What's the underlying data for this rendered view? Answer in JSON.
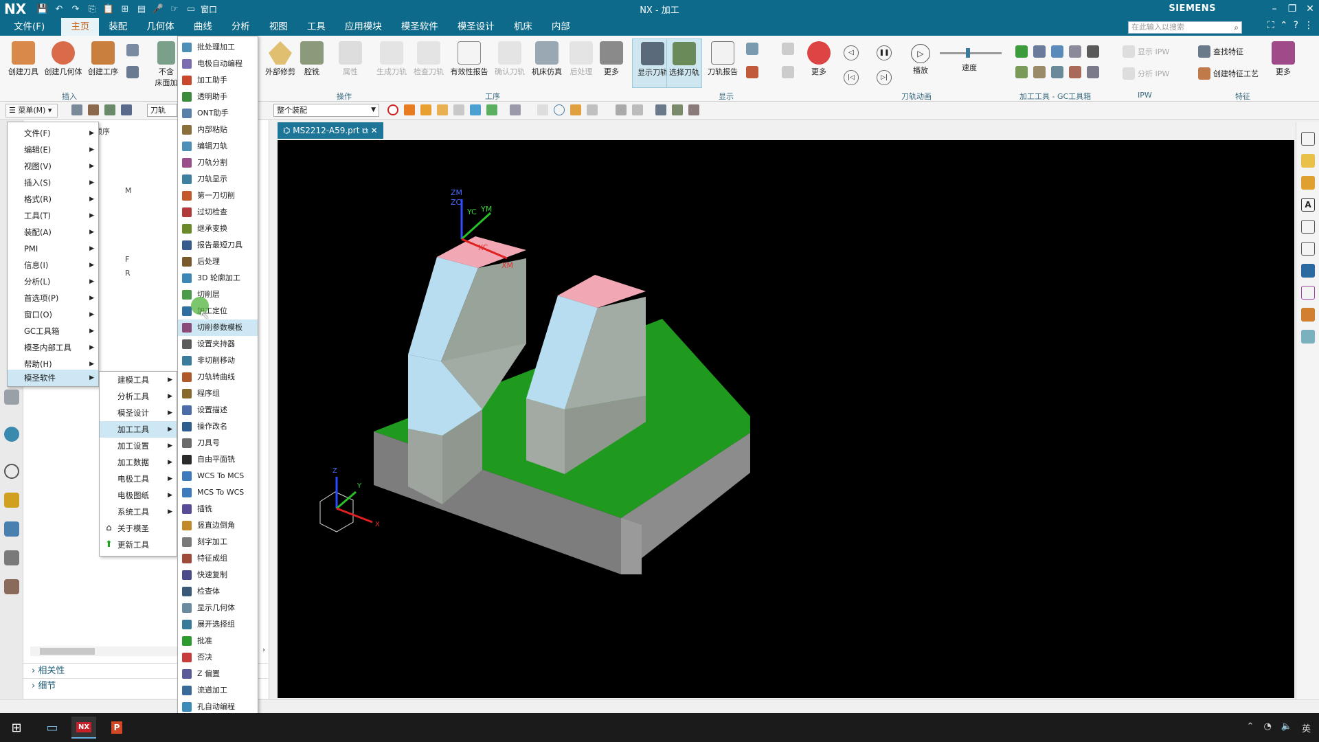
{
  "window": {
    "app_logo": "NX",
    "title": "NX - 加工",
    "brand": "SIEMENS",
    "controls": {
      "minimize": "–",
      "restore": "❐",
      "close": "✕"
    }
  },
  "quick_access": {
    "icons": [
      "save-icon",
      "undo-icon",
      "redo-icon",
      "copy-icon",
      "paste-icon",
      "snap-icon",
      "layer-icon",
      "mic-icon",
      "touch-icon",
      "window-icon"
    ],
    "window_label": "窗口"
  },
  "menu_tabs": [
    {
      "label": "文件(F)"
    },
    {
      "label": "主页"
    },
    {
      "label": "装配"
    },
    {
      "label": "几何体"
    },
    {
      "label": "曲线"
    },
    {
      "label": "分析"
    },
    {
      "label": "视图"
    },
    {
      "label": "工具"
    },
    {
      "label": "应用模块"
    },
    {
      "label": "模圣软件"
    },
    {
      "label": "模圣设计"
    },
    {
      "label": "机床"
    },
    {
      "label": "内部"
    }
  ],
  "active_tab": "主页",
  "search": {
    "placeholder": "在此输入以搜索"
  },
  "ribbon": {
    "insert_group": {
      "label": "插入",
      "buttons": [
        "创建刀具",
        "创建几何体",
        "创建工序"
      ]
    },
    "partial": {
      "label": "不含\n床面加"
    },
    "mid_buttons": [
      "外部修剪",
      "腔铣"
    ],
    "operation_group": {
      "label": "操作",
      "buttons": [
        "属性"
      ]
    },
    "process_group": {
      "label": "工序",
      "buttons": [
        "生成刀轨",
        "检查刀轨",
        "有效性报告",
        "确认刀轨",
        "机床仿真",
        "后处理",
        "更多"
      ]
    },
    "display_group": {
      "label": "显示",
      "buttons": [
        "显示刀轨",
        "选择刀轨",
        "刀轨报告"
      ]
    },
    "more_label": "更多",
    "animation_group": {
      "label": "刀轨动画",
      "play": "播放",
      "speed": "速度"
    },
    "gc_group": {
      "label": "加工工具 - GC工具箱"
    },
    "ipw_group": {
      "label": "IPW",
      "buttons": [
        "显示 IPW",
        "分析 IPW"
      ]
    },
    "feature_group": {
      "label": "特征",
      "buttons": [
        "查找特征",
        "创建特征工艺"
      ]
    },
    "last_more": "更多"
  },
  "toolbar2": {
    "menu_button": "菜单(M)",
    "filter_combo": "刀轨",
    "assembly_combo": "整个装配"
  },
  "main_menu": {
    "items": [
      {
        "label": "文件(F)"
      },
      {
        "label": "编辑(E)"
      },
      {
        "label": "视图(V)"
      },
      {
        "label": "插入(S)"
      },
      {
        "label": "格式(R)"
      },
      {
        "label": "工具(T)"
      },
      {
        "label": "装配(A)"
      },
      {
        "label": "PMI"
      },
      {
        "label": "信息(I)"
      },
      {
        "label": "分析(L)"
      },
      {
        "label": "首选项(P)"
      },
      {
        "label": "窗口(O)"
      },
      {
        "label": "GC工具箱"
      },
      {
        "label": "模圣内部工具"
      },
      {
        "label": "帮助(H)"
      },
      {
        "label": "模圣软件"
      }
    ],
    "highlighted_index": 15
  },
  "sub_menu": {
    "items": [
      {
        "label": "建模工具",
        "arrow": true
      },
      {
        "label": "分析工具",
        "arrow": true
      },
      {
        "label": "模圣设计",
        "arrow": true
      },
      {
        "label": "加工工具",
        "arrow": true
      },
      {
        "label": "加工设置",
        "arrow": true
      },
      {
        "label": "加工数据",
        "arrow": true
      },
      {
        "label": "电极工具",
        "arrow": true
      },
      {
        "label": "电极图纸",
        "arrow": true
      },
      {
        "label": "系统工具",
        "arrow": true
      },
      {
        "label": "关于模圣",
        "arrow": false
      },
      {
        "label": "更新工具",
        "arrow": false
      }
    ],
    "highlighted_index": 3
  },
  "tool_menu": {
    "items": [
      "批处理加工",
      "电极自动编程",
      "加工助手",
      "透明助手",
      "ONT助手",
      "内部粘贴",
      "编辑刀轨",
      "刀轨分割",
      "刀轨显示",
      "第一刀切削",
      "过切检查",
      "继承变换",
      "报告最短刀具",
      "后处理",
      "3D 轮廓加工",
      "切削层",
      "加工定位",
      "切削参数模板",
      "设置夹持器",
      "非切削移动",
      "刀轨转曲线",
      "程序组",
      "设置描述",
      "操作改名",
      "刀具号",
      "自由平面铣",
      "WCS To MCS",
      "MCS To WCS",
      "插铣",
      "竖直边倒角",
      "刻字加工",
      "特征成组",
      "快速复制",
      "检查体",
      "显示几何体",
      "展开选择组",
      "批准",
      "否决",
      "Z 偏置",
      "流道加工",
      "孔自动编程"
    ],
    "icon_colors": [
      "#4d8fb5",
      "#7b6bb0",
      "#c8492e",
      "#3c8c3c",
      "#5a7fa8",
      "#8c6e3c",
      "#4d8fb5",
      "#9a4f8c",
      "#3f7fa0",
      "#c4572b",
      "#b23a3a",
      "#6a8a2a",
      "#355c8c",
      "#7a5a2a",
      "#3e86b8",
      "#4a9a4a",
      "#2f6f9f",
      "#8a4a7a",
      "#5c5c5c",
      "#3c7c9c",
      "#b05a2a",
      "#8a6a2a",
      "#4b6bab",
      "#2e5e8e",
      "#6a6a6a",
      "#2a2a2a",
      "#3c7cbc",
      "#3c7cbc",
      "#5a4a9a",
      "#c08a2a",
      "#7a7a7a",
      "#a04a3a",
      "#4a4a8a",
      "#3a5a7a",
      "#6a8aa0",
      "#3a7a9a",
      "#2c9c2c",
      "#c83c3c",
      "#5a5a9a",
      "#3a6a9a",
      "#3a8aba"
    ],
    "highlighted_index": 17
  },
  "navigator": {
    "header": "顺序",
    "fragments": [
      "M",
      "F",
      "R"
    ],
    "sections": [
      "相关性",
      "细节"
    ]
  },
  "graphics": {
    "part_tab": "MS2212-A59.prt",
    "axis_labels": {
      "zm": "ZM",
      "zc": "ZC",
      "yc": "YC",
      "ym": "YM",
      "xc": "XC",
      "xm": "XM"
    },
    "triad_labels": {
      "x": "X",
      "y": "Y",
      "z": "Z"
    },
    "colors": {
      "background": "#000000",
      "base_top": "#1f9a1f",
      "base_side": "#7a7a7a",
      "block_face": "#b8dcf0",
      "block_side": "#9aa59c",
      "block_top": "#f2a8b4"
    }
  },
  "tray": {
    "ime": "英"
  }
}
